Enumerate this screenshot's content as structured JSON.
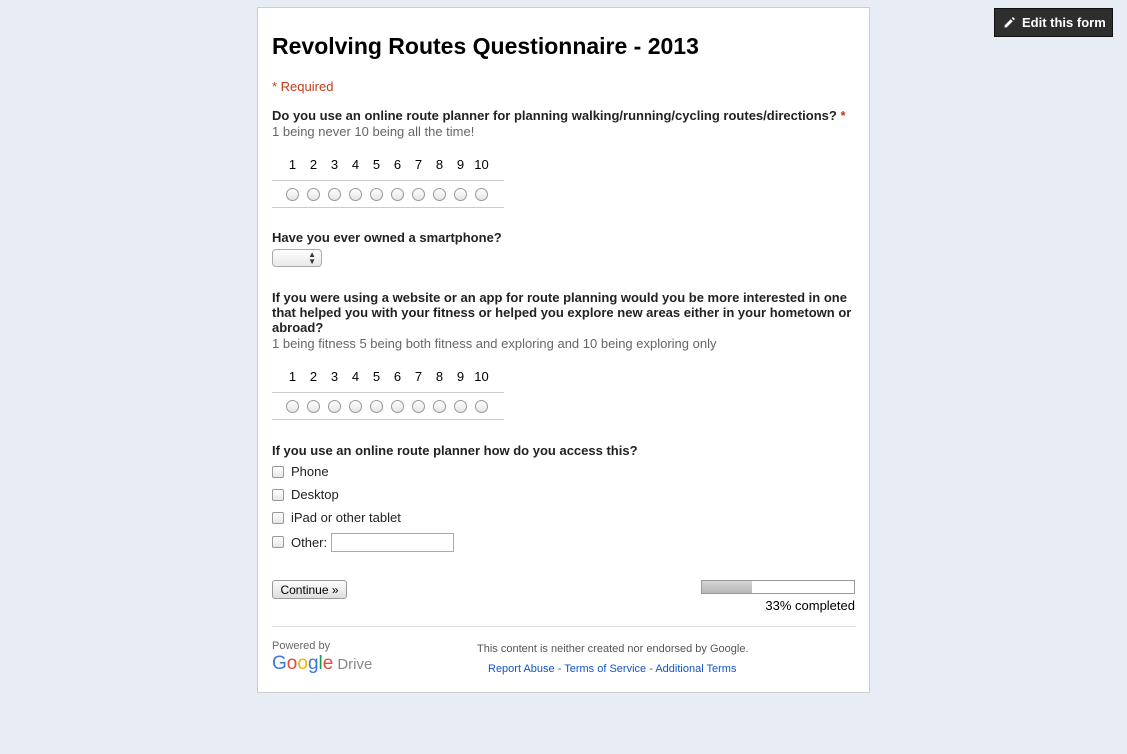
{
  "edit_button": {
    "label": "Edit this form",
    "icon": "pencil-icon"
  },
  "form": {
    "title": "Revolving Routes Questionnaire - 2013",
    "required_note": "* Required"
  },
  "questions": {
    "q1": {
      "title": "Do you use an online route planner for planning walking/running/cycling routes/directions?",
      "required_marker": "*",
      "help": "1 being never 10 being all the time!",
      "scale": [
        "1",
        "2",
        "3",
        "4",
        "5",
        "6",
        "7",
        "8",
        "9",
        "10"
      ]
    },
    "q2": {
      "title": "Have you ever owned a smartphone?",
      "selected_value": ""
    },
    "q3": {
      "title": "If you were using a website or an app for route planning would you be more interested in one that helped you with your fitness or helped you explore new areas either in your hometown or abroad?",
      "help": "1 being fitness 5 being both fitness and exploring and 10 being exploring only",
      "scale": [
        "1",
        "2",
        "3",
        "4",
        "5",
        "6",
        "7",
        "8",
        "9",
        "10"
      ]
    },
    "q4": {
      "title": "If you use an online route planner how do you access this?",
      "options": [
        "Phone",
        "Desktop",
        "iPad or other tablet"
      ],
      "other_label": "Other:",
      "other_value": ""
    }
  },
  "navigation": {
    "continue_label": "Continue »",
    "progress_percent": 33,
    "progress_label": "33% completed"
  },
  "footer": {
    "powered_by": "Powered by",
    "google_word": "Google",
    "drive_word": "Drive",
    "disclaimer": "This content is neither created nor endorsed by Google.",
    "links": [
      "Report Abuse",
      "Terms of Service",
      "Additional Terms"
    ],
    "separator": " - "
  },
  "colors": {
    "background": "#e8edf5",
    "required": "#c43b1d",
    "link": "#1155cc"
  }
}
